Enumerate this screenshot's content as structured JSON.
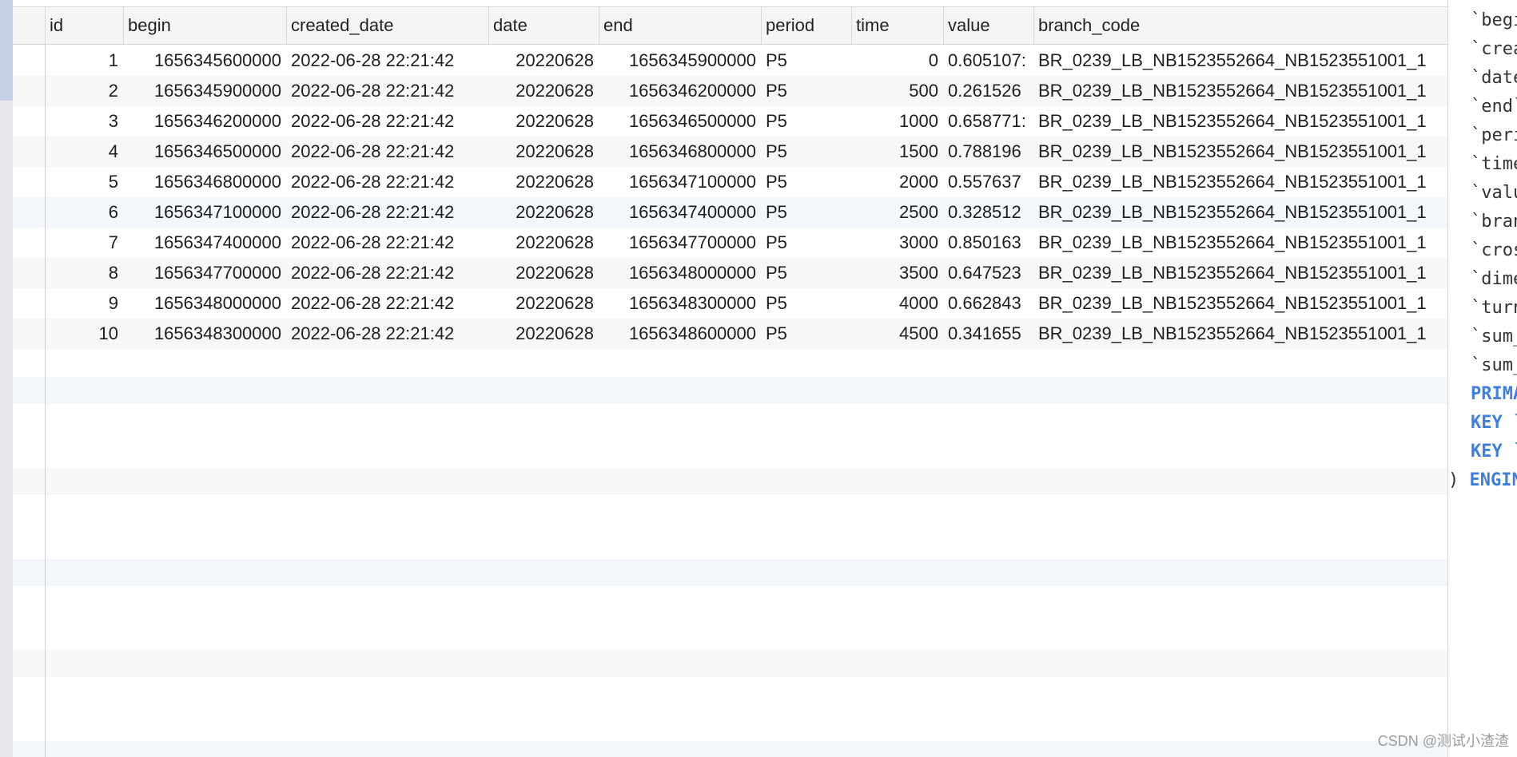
{
  "table": {
    "columns": [
      "id",
      "begin",
      "created_date",
      "date",
      "end",
      "period",
      "time",
      "value",
      "branch_code"
    ],
    "rows": [
      {
        "id": "1",
        "begin": "1656345600000",
        "created_date": "2022-06-28 22:21:42",
        "date": "20220628",
        "end": "1656345900000",
        "period": "P5",
        "time": "0",
        "value": "0.605107:",
        "branch_code": "BR_0239_LB_NB1523552664_NB1523551001_1"
      },
      {
        "id": "2",
        "begin": "1656345900000",
        "created_date": "2022-06-28 22:21:42",
        "date": "20220628",
        "end": "1656346200000",
        "period": "P5",
        "time": "500",
        "value": "0.261526",
        "branch_code": "BR_0239_LB_NB1523552664_NB1523551001_1"
      },
      {
        "id": "3",
        "begin": "1656346200000",
        "created_date": "2022-06-28 22:21:42",
        "date": "20220628",
        "end": "1656346500000",
        "period": "P5",
        "time": "1000",
        "value": "0.658771:",
        "branch_code": "BR_0239_LB_NB1523552664_NB1523551001_1"
      },
      {
        "id": "4",
        "begin": "1656346500000",
        "created_date": "2022-06-28 22:21:42",
        "date": "20220628",
        "end": "1656346800000",
        "period": "P5",
        "time": "1500",
        "value": "0.788196",
        "branch_code": "BR_0239_LB_NB1523552664_NB1523551001_1"
      },
      {
        "id": "5",
        "begin": "1656346800000",
        "created_date": "2022-06-28 22:21:42",
        "date": "20220628",
        "end": "1656347100000",
        "period": "P5",
        "time": "2000",
        "value": "0.557637",
        "branch_code": "BR_0239_LB_NB1523552664_NB1523551001_1"
      },
      {
        "id": "6",
        "begin": "1656347100000",
        "created_date": "2022-06-28 22:21:42",
        "date": "20220628",
        "end": "1656347400000",
        "period": "P5",
        "time": "2500",
        "value": "0.328512",
        "branch_code": "BR_0239_LB_NB1523552664_NB1523551001_1"
      },
      {
        "id": "7",
        "begin": "1656347400000",
        "created_date": "2022-06-28 22:21:42",
        "date": "20220628",
        "end": "1656347700000",
        "period": "P5",
        "time": "3000",
        "value": "0.850163",
        "branch_code": "BR_0239_LB_NB1523552664_NB1523551001_1"
      },
      {
        "id": "8",
        "begin": "1656347700000",
        "created_date": "2022-06-28 22:21:42",
        "date": "20220628",
        "end": "1656348000000",
        "period": "P5",
        "time": "3500",
        "value": "0.647523",
        "branch_code": "BR_0239_LB_NB1523552664_NB1523551001_1"
      },
      {
        "id": "9",
        "begin": "1656348000000",
        "created_date": "2022-06-28 22:21:42",
        "date": "20220628",
        "end": "1656348300000",
        "period": "P5",
        "time": "4000",
        "value": "0.662843",
        "branch_code": "BR_0239_LB_NB1523552664_NB1523551001_1"
      },
      {
        "id": "10",
        "begin": "1656348300000",
        "created_date": "2022-06-28 22:21:42",
        "date": "20220628",
        "end": "1656348600000",
        "period": "P5",
        "time": "4500",
        "value": "0.341655",
        "branch_code": "BR_0239_LB_NB1523552664_NB1523551001_1"
      }
    ]
  },
  "ddl_panel": {
    "lines": [
      "`begi",
      "`crea",
      "`date",
      "`end`",
      "`peri",
      "`time",
      "`valu",
      "`bran",
      "`cros",
      "`dime",
      "`turn",
      "`sum_",
      "`sum_",
      "PRIMA",
      "KEY `",
      "KEY `",
      ") ENGIN"
    ]
  },
  "watermark": "CSDN @测试小渣渣"
}
